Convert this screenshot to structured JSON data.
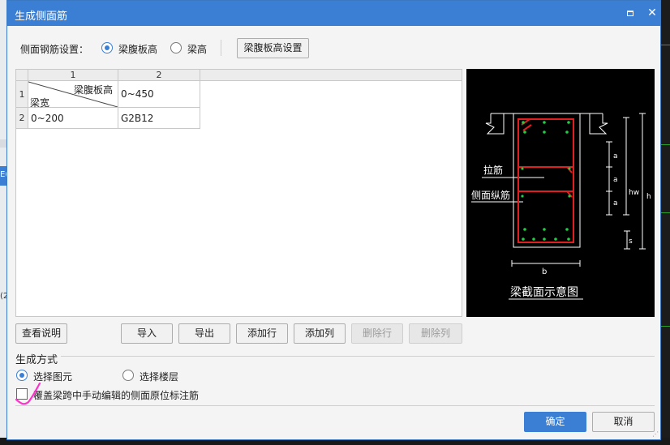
{
  "dialog": {
    "title": "生成侧面筋",
    "max_glyph": "□",
    "close_glyph": "✕"
  },
  "settings": {
    "label": "侧面钢筋设置：",
    "radio_web_height": "梁腹板高",
    "radio_beam_height": "梁高",
    "selected": "梁腹板高",
    "web_height_setting_button": "梁腹板高设置"
  },
  "grid": {
    "column_headers": [
      "1",
      "2"
    ],
    "row_headers": [
      "1",
      "2"
    ],
    "corner_top": "梁腹板高",
    "corner_bottom": "梁宽",
    "row1_col2": "0~450",
    "row2_col1": "0~200",
    "row2_col2": "G2B12"
  },
  "diagram": {
    "label_tie_bar": "拉筋",
    "label_side_bar": "侧面纵筋",
    "label_a1": "a",
    "label_a2": "a",
    "label_a3": "a",
    "label_hw": "hw",
    "label_h": "h",
    "label_s": "s",
    "label_b": "b",
    "caption": "梁截面示意图",
    "bar_color": "#e02020",
    "rebar_color": "#22cc44",
    "line_color": "#ffffff"
  },
  "buttons": {
    "view_help": "查看说明",
    "import": "导入",
    "export": "导出",
    "add_row": "添加行",
    "add_column": "添加列",
    "delete_row": "删除行",
    "delete_column": "删除列",
    "ok": "确定",
    "cancel": "取消"
  },
  "generation": {
    "title": "生成方式",
    "option_select_element": "选择图元",
    "option_select_floor": "选择楼层",
    "selected": "选择图元",
    "overwrite_label": "覆盖梁跨中手动编辑的侧面原位标注筋",
    "overwrite_checked": false
  },
  "colors": {
    "accent": "#3b7fd4",
    "annotation_mark": "#ff33cc"
  },
  "background": {
    "left_fragment_1": "E(",
    "left_fragment_2": "(2"
  }
}
